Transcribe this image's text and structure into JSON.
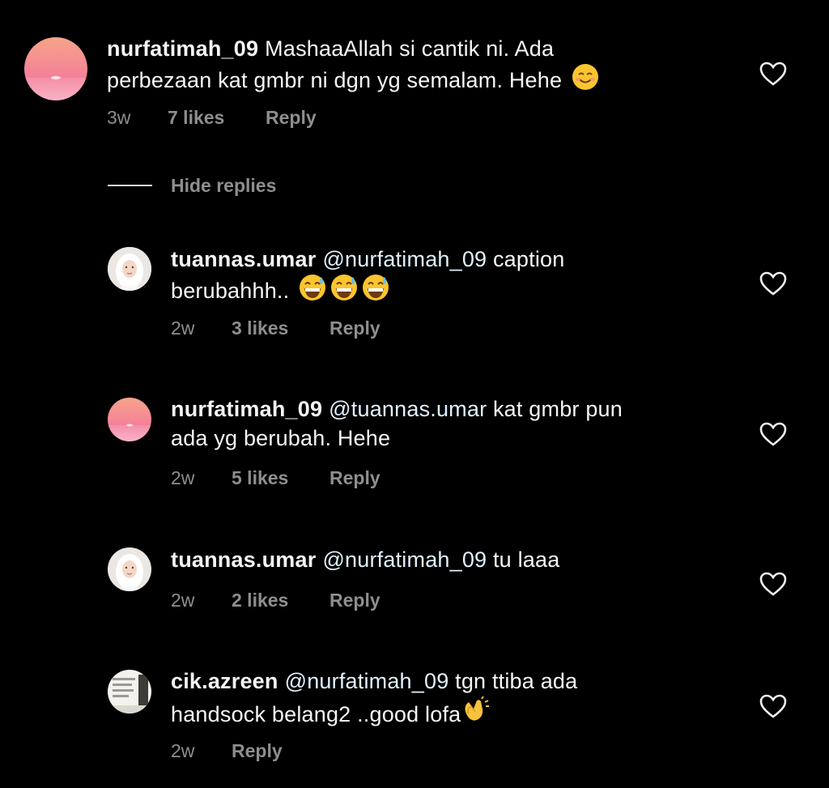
{
  "comments": [
    {
      "username": "nurfatimah_09",
      "mention": "",
      "line1": "MashaaAllah si cantik ni. Ada",
      "line2": "perbezaan kat gmbr ni dgn yg semalam. Hehe",
      "emoji": "smiling-face",
      "time": "3w",
      "likes": "7 likes",
      "reply": "Reply"
    },
    {
      "username": "tuannas.umar",
      "mention": "@nurfatimah_09",
      "line1": "caption",
      "line2": "berubahhh..",
      "emoji": "grinning-sweat-face x3",
      "time": "2w",
      "likes": "3 likes",
      "reply": "Reply"
    },
    {
      "username": "nurfatimah_09",
      "mention": "@tuannas.umar",
      "line1": "kat gmbr pun",
      "line2": "ada yg berubah. Hehe",
      "time": "2w",
      "likes": "5 likes",
      "reply": "Reply"
    },
    {
      "username": "tuannas.umar",
      "mention": "@nurfatimah_09",
      "line1": "tu laaa",
      "time": "2w",
      "likes": "2 likes",
      "reply": "Reply"
    },
    {
      "username": "cik.azreen",
      "mention": "@nurfatimah_09",
      "line1": "tgn ttiba ada",
      "line2": "handsock belang2 ..good lofa",
      "emoji": "clapping-hands",
      "time": "2w",
      "reply": "Reply"
    }
  ],
  "hide_replies": "Hide replies",
  "icons": {
    "heart": "heart-outline-icon"
  },
  "colors": {
    "background": "#000000",
    "text": "#f5f5f5",
    "meta": "#8e8e8e",
    "mention": "#e0f1ff"
  }
}
